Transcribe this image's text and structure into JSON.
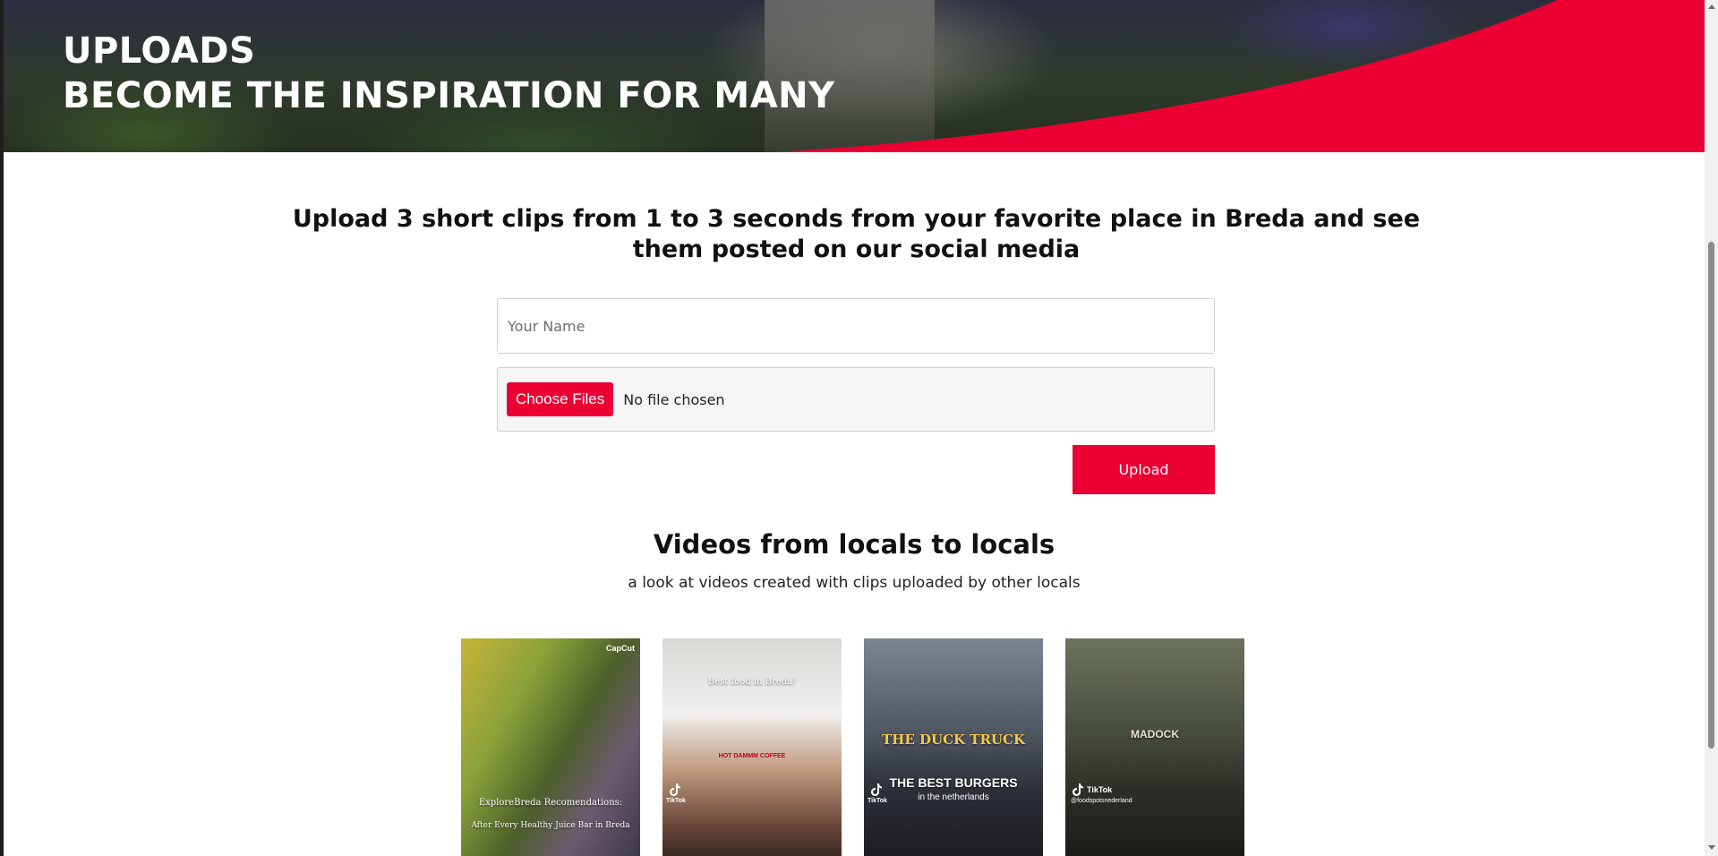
{
  "hero": {
    "line1": "UPLOADS",
    "line2": "BECOME THE INSPIRATION FOR MANY"
  },
  "colors": {
    "accent": "#ec0033"
  },
  "main": {
    "heading": "Upload 3 short clips from 1 to 3 seconds from your favorite place in Breda and see them posted on our social media"
  },
  "form": {
    "name_placeholder": "Your Name",
    "name_value": "",
    "choose_files_label": "Choose Files",
    "file_status": "No file chosen",
    "upload_label": "Upload"
  },
  "videos": {
    "heading": "Videos from locals to locals",
    "subheading": "a look at videos created with clips uploaded by other locals",
    "thumbnails": [
      {
        "badge": "CapCut",
        "caption1": "ExploreBreda Recomendations:",
        "caption2": "After Every Healthy Juice Bar in Breda"
      },
      {
        "caption1": "Best food in Breda!",
        "badge": "TikTok",
        "sub": "HOT DAMMM COFFEE"
      },
      {
        "sign": "THE DUCK TRUCK",
        "title": "THE BEST BURGERS",
        "sub": "in the netherlands",
        "badge": "TikTok"
      },
      {
        "sign": "MADOCK",
        "badge": "TikTok",
        "handle": "@foodspotsnederland"
      }
    ]
  }
}
